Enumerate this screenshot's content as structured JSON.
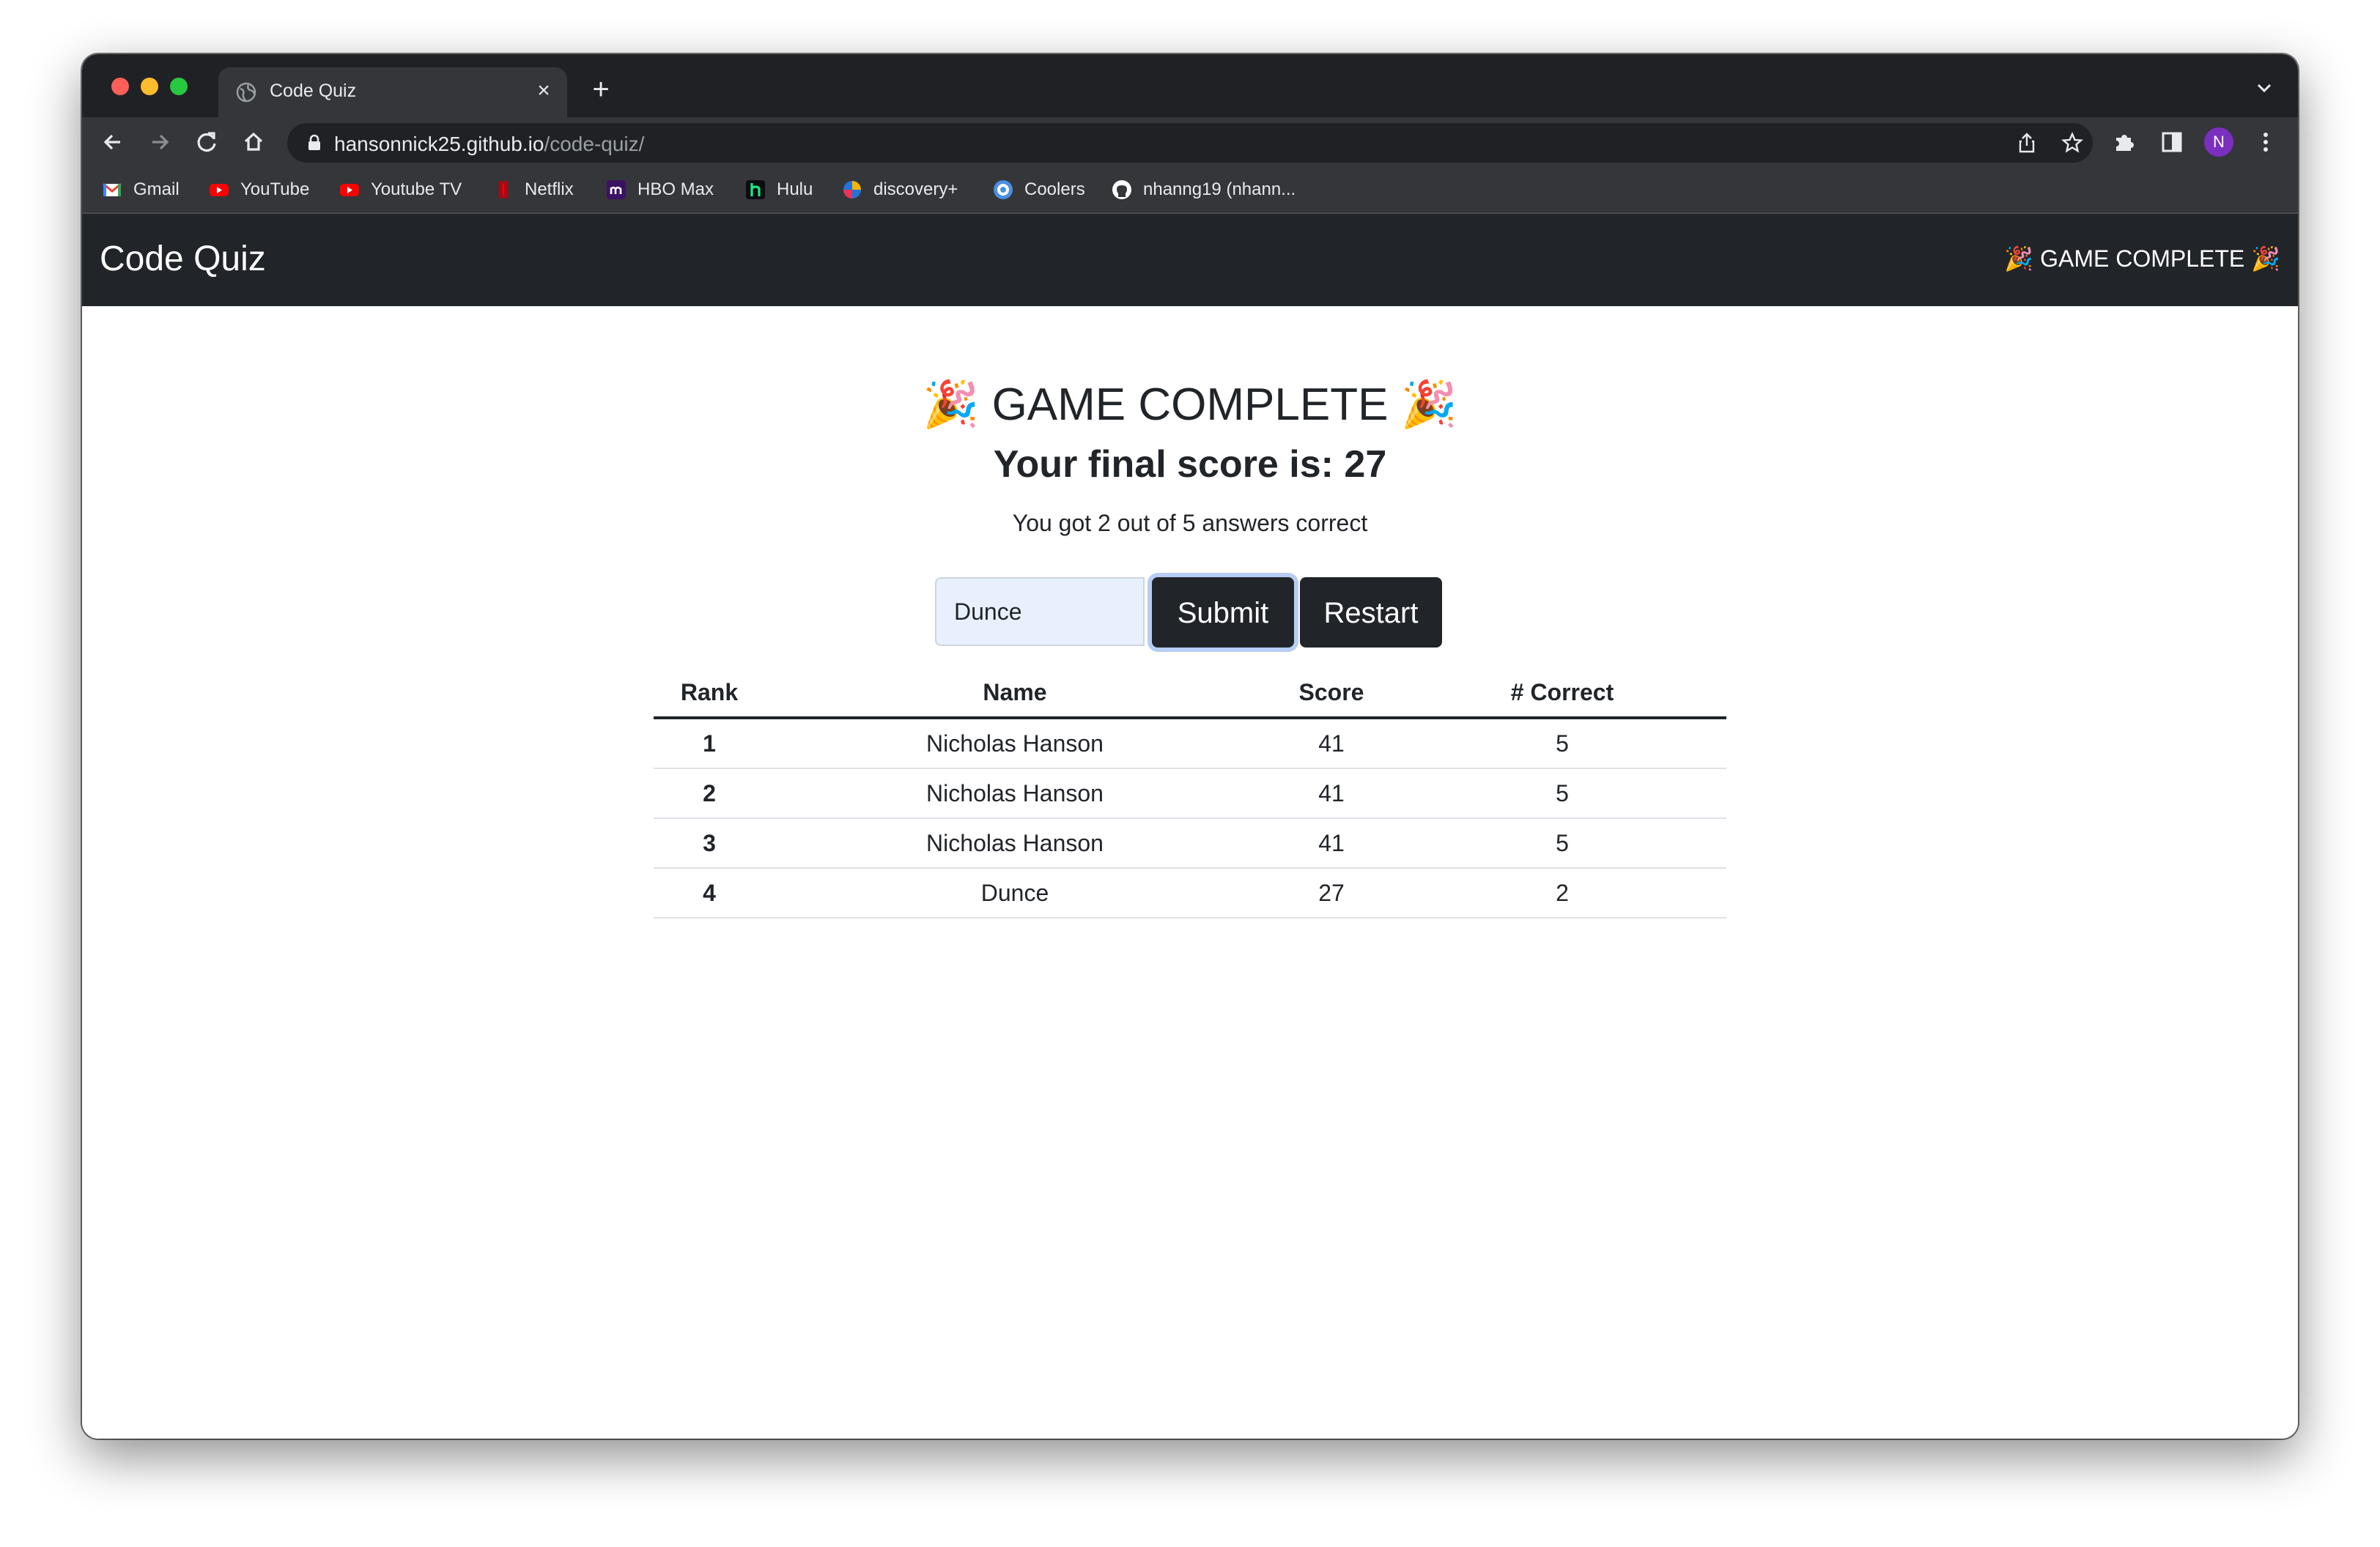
{
  "browser": {
    "tab_title": "Code Quiz",
    "url_host": "hansonnick25.github.io",
    "url_path": "/code-quiz/",
    "profile_initial": "N",
    "bookmarks": [
      {
        "label": "Gmail",
        "icon": "gmail-icon"
      },
      {
        "label": "YouTube",
        "icon": "youtube-icon"
      },
      {
        "label": "Youtube TV",
        "icon": "youtube-tv-icon"
      },
      {
        "label": "Netflix",
        "icon": "netflix-icon"
      },
      {
        "label": "HBO Max",
        "icon": "hbo-max-icon"
      },
      {
        "label": "Hulu",
        "icon": "hulu-icon"
      },
      {
        "label": "discovery+",
        "icon": "discovery-plus-icon"
      },
      {
        "label": "Coolers",
        "icon": "coolers-icon"
      },
      {
        "label": "nhanng19 (nhann...",
        "icon": "github-icon"
      }
    ]
  },
  "app": {
    "brand": "Code Quiz",
    "nav_status": "🎉 GAME COMPLETE 🎉"
  },
  "main": {
    "heading": "🎉 GAME COMPLETE 🎉",
    "score_heading": "Your final score is: 27",
    "subtitle": "You got 2 out of 5 answers correct",
    "name_input_value": "Dunce",
    "submit_label": "Submit",
    "restart_label": "Restart"
  },
  "leaderboard": {
    "columns": [
      "Rank",
      "Name",
      "Score",
      "# Correct"
    ],
    "rows": [
      [
        "1",
        "Nicholas Hanson",
        "41",
        "5"
      ],
      [
        "2",
        "Nicholas Hanson",
        "41",
        "5"
      ],
      [
        "3",
        "Nicholas Hanson",
        "41",
        "5"
      ],
      [
        "4",
        "Dunce",
        "27",
        "2"
      ]
    ]
  },
  "colors": {
    "navbar_bg": "#212529",
    "button_bg": "#212529",
    "input_bg": "#e8f0fe",
    "browser_chrome": "#35363a",
    "profile_avatar": "#7b2fbf"
  }
}
